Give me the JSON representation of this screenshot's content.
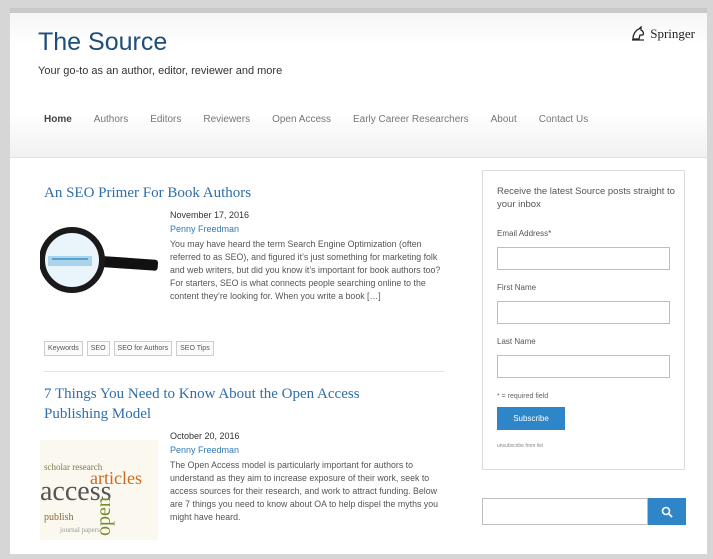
{
  "site": {
    "title": "The Source",
    "tagline": "Your go-to as an author, editor, reviewer and more",
    "brand": "Springer"
  },
  "nav": {
    "items": [
      "Home",
      "Authors",
      "Editors",
      "Reviewers",
      "Open Access",
      "Early Career Researchers",
      "About",
      "Contact Us"
    ],
    "active": "Home"
  },
  "posts": [
    {
      "title": "An SEO Primer For Book Authors",
      "date": "November 17, 2016",
      "author": "Penny Freedman",
      "excerpt": "You may have heard the term Search Engine Optimization (often referred to as SEO), and figured it’s just something for marketing folk and web writers, but did you know it’s important for book authors too? For starters, SEO is what connects people searching online to the content they’re looking for. When you write a book […]",
      "tags": [
        "Keywords",
        "SEO",
        "SEO for Authors",
        "SEO Tips"
      ],
      "thumb_icon": "magnifying-glass-icon"
    },
    {
      "title_line1": "7 Things You Need to Know About the Open Access",
      "title_line2": "Publishing Model",
      "date": "October 20, 2016",
      "author": "Penny Freedman",
      "excerpt": "The Open Access model is particularly important for authors to understand as they aim to increase exposure of their work, seek to access sources for their research, and work to attract funding. Below are 7 things you need to know about OA to help dispel the myths you might have heard.",
      "thumb_words": [
        "access",
        "articles",
        "open",
        "publish"
      ]
    }
  ],
  "sidebar": {
    "heading": "Receive the latest Source posts straight to your inbox",
    "email_label": "Email Address*",
    "first_name_label": "First Name",
    "last_name_label": "Last Name",
    "required_note": "* = required field",
    "subscribe_label": "Subscribe",
    "unsubscribe_text": "unsubscribe from list"
  },
  "search": {
    "icon": "search-icon"
  },
  "colors": {
    "title_blue": "#1f4e79",
    "link_blue": "#2f6ea8",
    "button_blue": "#2e86c9"
  }
}
